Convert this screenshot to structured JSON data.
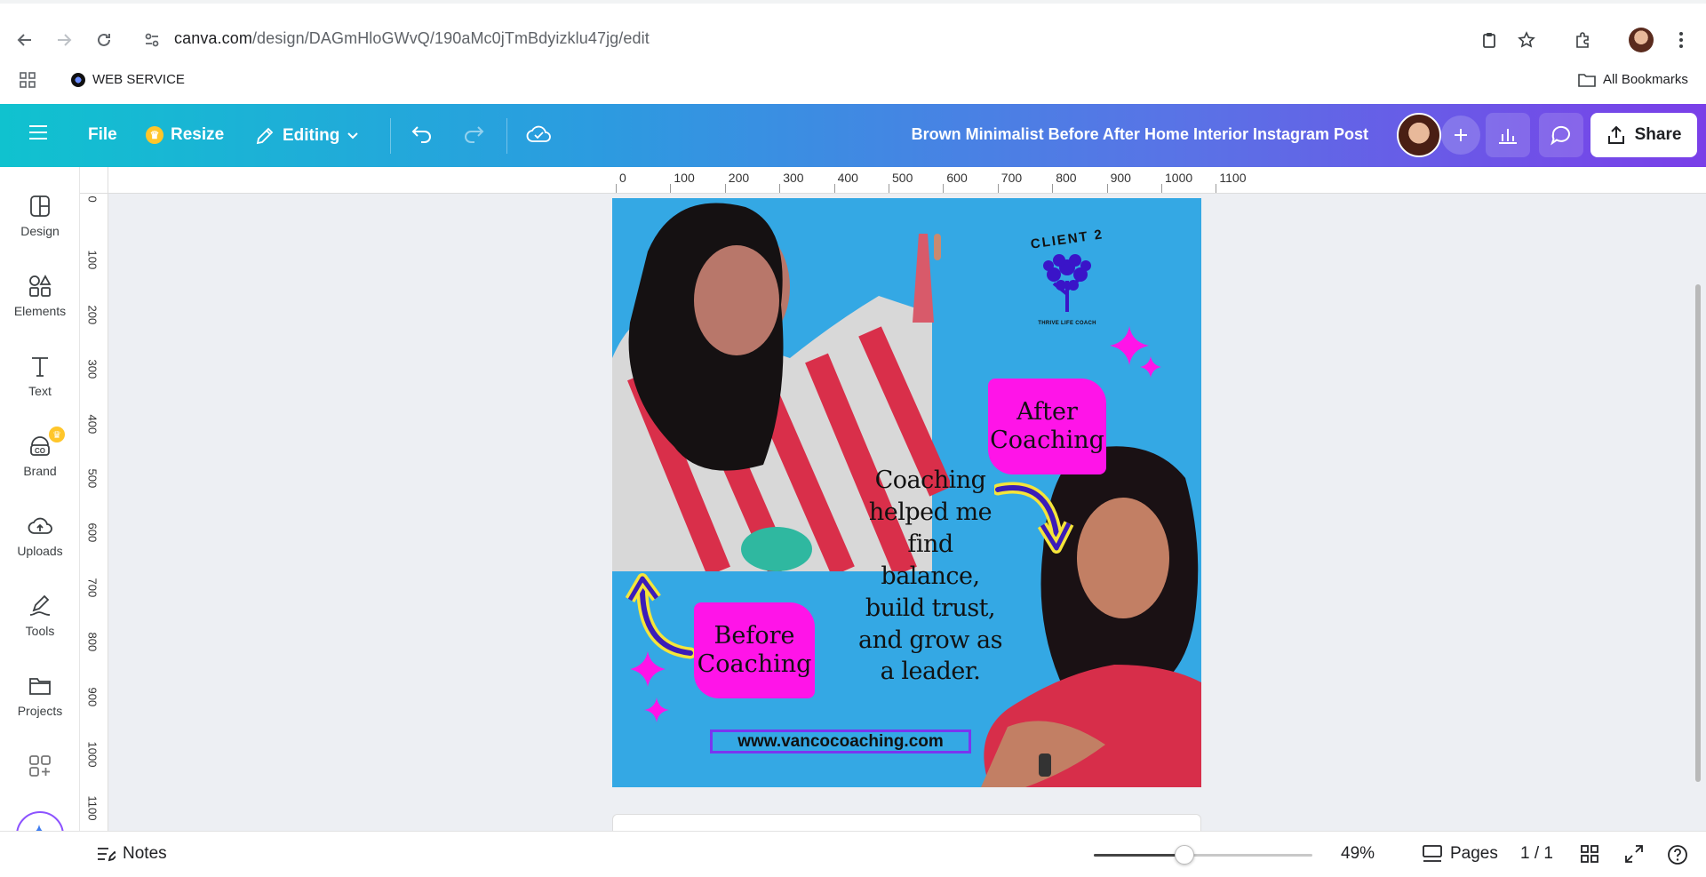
{
  "browser": {
    "url_host": "canva.com",
    "url_path": "/design/DAGmHloGWvQ/190aMc0jTmBdyizklu47jg/edit",
    "bookmarks": [
      {
        "label": "WEB SERVICE"
      }
    ],
    "all_bookmarks_label": "All Bookmarks"
  },
  "toolbar": {
    "file_label": "File",
    "resize_label": "Resize",
    "editing_label": "Editing",
    "doc_title": "Brown Minimalist Before After Home Interior Instagram Post",
    "share_label": "Share"
  },
  "sidebar": {
    "items": [
      {
        "label": "Design"
      },
      {
        "label": "Elements"
      },
      {
        "label": "Text"
      },
      {
        "label": "Brand"
      },
      {
        "label": "Uploads"
      },
      {
        "label": "Tools"
      },
      {
        "label": "Projects"
      }
    ]
  },
  "rulers": {
    "top_ticks": [
      "0",
      "100",
      "200",
      "300",
      "400",
      "500",
      "600",
      "700",
      "800",
      "900",
      "1000",
      "1100"
    ],
    "left_ticks": [
      "0",
      "100",
      "200",
      "300",
      "400",
      "500",
      "600",
      "700",
      "800",
      "900",
      "1000",
      "1100"
    ]
  },
  "design": {
    "logo_title": "CLIENT 2",
    "logo_subtitle": "THRIVE LIFE COACH",
    "after_label": "After Coaching",
    "before_label": "Before Coaching",
    "quote": "Coaching helped me find balance, build trust, and grow as a leader.",
    "website": "www.vancocoaching.com",
    "background_color": "#34a8e4",
    "accent_color": "#ff14e8"
  },
  "footer": {
    "notes_label": "Notes",
    "zoom_value": 49,
    "zoom_label": "49%",
    "pages_label": "Pages",
    "page_count": "1 / 1"
  },
  "colors": {
    "toolbar_start": "#10c2cf",
    "toolbar_end": "#7a3fe8",
    "workspace": "#edeff3"
  }
}
